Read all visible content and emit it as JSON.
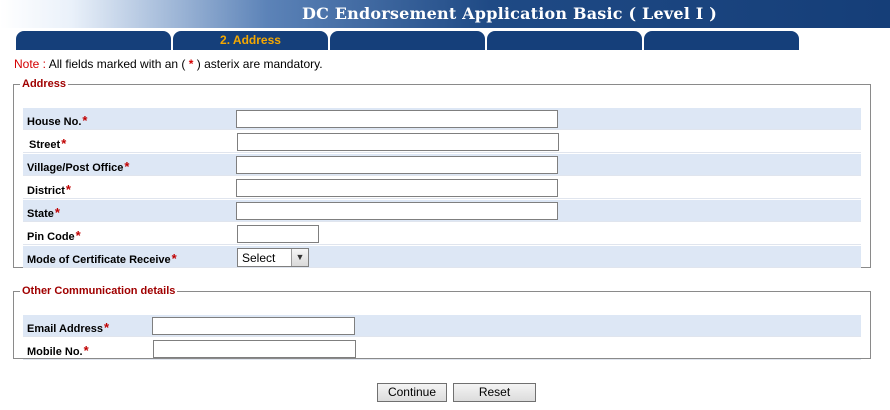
{
  "header": {
    "title": "DC Endorsement Application Basic ( Level I )"
  },
  "tabs": [
    {
      "label": ""
    },
    {
      "label": "2. Address"
    },
    {
      "label": ""
    },
    {
      "label": ""
    },
    {
      "label": ""
    },
    {
      "label": ""
    }
  ],
  "note": {
    "label": "Note :",
    "text_before": "All fields marked with an (",
    "star": "*",
    "text_after": ") asterix are mandatory."
  },
  "address_section": {
    "legend": "Address",
    "fields": [
      {
        "label": "House No.",
        "required": "*",
        "value": ""
      },
      {
        "label": "Street",
        "required": "*",
        "value": ""
      },
      {
        "label": "Village/Post Office",
        "required": "*",
        "value": ""
      },
      {
        "label": "District",
        "required": "*",
        "value": ""
      },
      {
        "label": "State",
        "required": "*",
        "value": ""
      },
      {
        "label": "Pin Code",
        "required": "*",
        "value": ""
      },
      {
        "label": "Mode of Certificate Receive",
        "required": "*",
        "selected": "Select"
      }
    ]
  },
  "communication_section": {
    "legend": "Other Communication details",
    "fields": [
      {
        "label": "Email Address",
        "required": "*",
        "value": ""
      },
      {
        "label": "Mobile No.",
        "required": "*",
        "value": ""
      }
    ]
  },
  "buttons": {
    "continue": "Continue",
    "reset": "Reset"
  },
  "icons": {
    "dropdown": "chevron-down-icon"
  },
  "colors": {
    "header_dark": "#153e78",
    "tab_text": "#f5a800",
    "required": "#c00000",
    "row_shade": "#dde7f5"
  }
}
